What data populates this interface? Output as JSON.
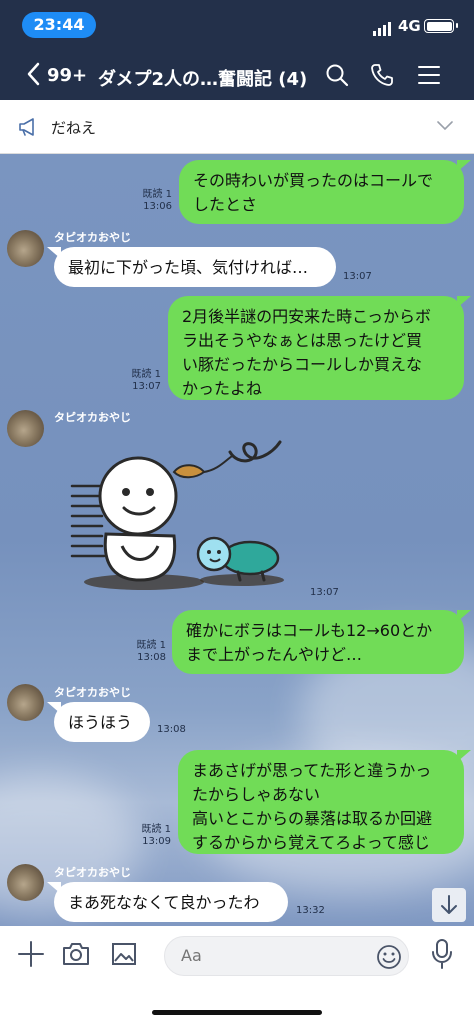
{
  "status_bar": {
    "time": "23:44",
    "network": "4G"
  },
  "header": {
    "back_count": "99+",
    "title": "ダメプ2人の…奮闘記 (4)"
  },
  "announcement": {
    "text": "だねえ"
  },
  "messages": [
    {
      "from": "me",
      "lines": [
        "その時わいが買ったのはコールで",
        "したとさ"
      ],
      "read": "既読 1",
      "time": "13:06"
    },
    {
      "from": "them",
      "sender": "タピオカおやじ",
      "lines": [
        "最初に下がった頃、気付ければ…"
      ],
      "time": "13:07"
    },
    {
      "from": "me",
      "lines": [
        "2月後半謎の円安来た時こっからボ",
        "ラ出そうやなぁとは思ったけど買",
        "い豚だったからコールしか買えな",
        "かったよね"
      ],
      "read": "既読 1",
      "time": "13:07"
    },
    {
      "from": "them",
      "sender": "タピオカおやじ",
      "sticker": true,
      "time": "13:07"
    },
    {
      "from": "me",
      "lines": [
        "確かにボラはコールも12→60とか",
        "まで上がったんやけど…"
      ],
      "read": "既読 1",
      "time": "13:08"
    },
    {
      "from": "them",
      "sender": "タピオカおやじ",
      "lines": [
        "ほうほう"
      ],
      "time": "13:08"
    },
    {
      "from": "me",
      "lines": [
        "まあさげが思ってた形と違うかっ",
        "たからしゃあない",
        "高いとこからの暴落は取るか回避",
        "するからから覚えてろよって感じ"
      ],
      "read": "既読 1",
      "time": "13:09"
    },
    {
      "from": "them",
      "sender": "タピオカおやじ",
      "lines": [
        "まあ死ななくて良かったわ"
      ],
      "time": "13:32"
    }
  ],
  "input": {
    "placeholder": "Aa"
  },
  "colors": {
    "header_bg": "#23304a",
    "my_bubble": "#71dc57",
    "chat_bg": "#7a95c0",
    "time_pill": "#1e8cf5"
  },
  "icons": [
    "back-chevron-icon",
    "search-icon",
    "phone-icon",
    "menu-icon",
    "megaphone-icon",
    "chevron-down-icon",
    "plus-icon",
    "camera-icon",
    "image-icon",
    "smile-icon",
    "mic-icon",
    "arrow-down-icon"
  ]
}
